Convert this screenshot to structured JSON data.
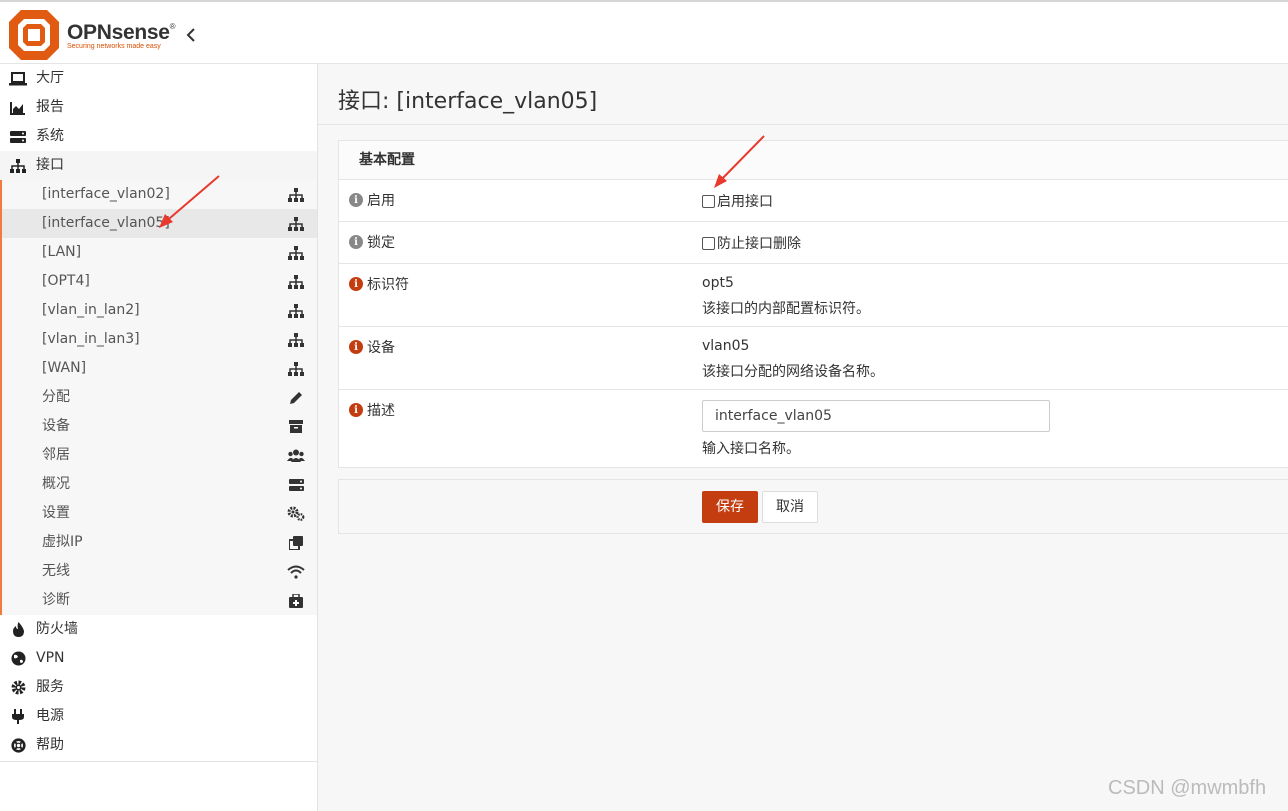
{
  "brand": {
    "name": "OPNsense",
    "registered": "®",
    "tagline": "Securing networks made easy"
  },
  "sidebar": {
    "top_items": [
      {
        "label": "大厅",
        "icon": "laptop-icon"
      },
      {
        "label": "报告",
        "icon": "area-chart-icon"
      },
      {
        "label": "系统",
        "icon": "server-icon"
      },
      {
        "label": "接口",
        "icon": "sitemap-icon"
      }
    ],
    "interfaces_submenu": [
      {
        "label": "[interface_vlan02]",
        "icon": "sitemap-icon"
      },
      {
        "label": "[interface_vlan05]",
        "icon": "sitemap-icon"
      },
      {
        "label": "[LAN]",
        "icon": "sitemap-icon"
      },
      {
        "label": "[OPT4]",
        "icon": "sitemap-icon"
      },
      {
        "label": "[vlan_in_lan2]",
        "icon": "sitemap-icon"
      },
      {
        "label": "[vlan_in_lan3]",
        "icon": "sitemap-icon"
      },
      {
        "label": "[WAN]",
        "icon": "sitemap-icon"
      },
      {
        "label": "分配",
        "icon": "pencil-icon"
      },
      {
        "label": "设备",
        "icon": "archive-icon"
      },
      {
        "label": "邻居",
        "icon": "users-icon"
      },
      {
        "label": "概况",
        "icon": "server-icon"
      },
      {
        "label": "设置",
        "icon": "cogs-icon"
      },
      {
        "label": "虚拟IP",
        "icon": "clone-icon"
      },
      {
        "label": "无线",
        "icon": "wifi-icon"
      },
      {
        "label": "诊断",
        "icon": "medkit-icon"
      }
    ],
    "bottom_items": [
      {
        "label": "防火墙",
        "icon": "fire-icon"
      },
      {
        "label": "VPN",
        "icon": "globe-icon"
      },
      {
        "label": "服务",
        "icon": "cog-icon"
      },
      {
        "label": "电源",
        "icon": "plug-icon"
      },
      {
        "label": "帮助",
        "icon": "life-ring-icon"
      }
    ]
  },
  "page": {
    "title": "接口: [interface_vlan05]"
  },
  "panel": {
    "heading": "基本配置",
    "enable": {
      "label": "启用",
      "checkbox_label": "启用接口",
      "checked": false
    },
    "lock": {
      "label": "锁定",
      "checkbox_label": "防止接口删除",
      "checked": false
    },
    "identifier": {
      "label": "标识符",
      "value": "opt5",
      "hint": "该接口的内部配置标识符。"
    },
    "device": {
      "label": "设备",
      "value": "vlan05",
      "hint": "该接口分配的网络设备名称。"
    },
    "description": {
      "label": "描述",
      "value": "interface_vlan05",
      "hint": "输入接口名称。"
    }
  },
  "actions": {
    "save_label": "保存",
    "cancel_label": "取消"
  },
  "colors": {
    "accent": "#c33d11",
    "brand_orange": "#d94f00"
  },
  "watermark": "CSDN @mwmbfh"
}
